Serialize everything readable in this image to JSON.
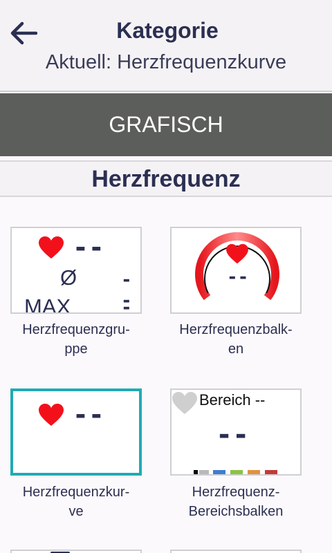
{
  "header": {
    "title": "Kategorie",
    "subtitle": "Aktuell: Herzfrequenzkurve",
    "back_icon": "arrow-left-icon"
  },
  "category_button": {
    "label": "GRAFISCH"
  },
  "section": {
    "title": "Herzfrequenz"
  },
  "tiles": [
    {
      "label_line1": "Herzfrequenzgru-",
      "label_line2": "ppe",
      "value": "--",
      "avg_symbol": "Ø",
      "avg_value": "--",
      "max_label": "MAX",
      "max_value": "--",
      "icon": "heart-icon",
      "selected": false
    },
    {
      "label_line1": "Herzfrequenzbalk-",
      "label_line2": "en",
      "value": "--",
      "icon": "heart-icon",
      "selected": false
    },
    {
      "label_line1": "Herzfrequenzkur-",
      "label_line2": "ve",
      "value": "--",
      "icon": "heart-icon",
      "selected": true
    },
    {
      "label_line1": "Herzfrequenz-",
      "label_line2": "Bereichsbalken",
      "zone_label": "Bereich --",
      "value": "--",
      "icon": "heart-gray-icon",
      "zone_colors": [
        "#000000",
        "#b9b9b9",
        "#3d7ed1",
        "#8ac440",
        "#e2913d",
        "#c23b35"
      ],
      "selected": false
    }
  ],
  "colors": {
    "accent": "#20aab4",
    "heart": "#f2111b",
    "bar": "#5c5e5b",
    "text": "#2b2f52"
  }
}
